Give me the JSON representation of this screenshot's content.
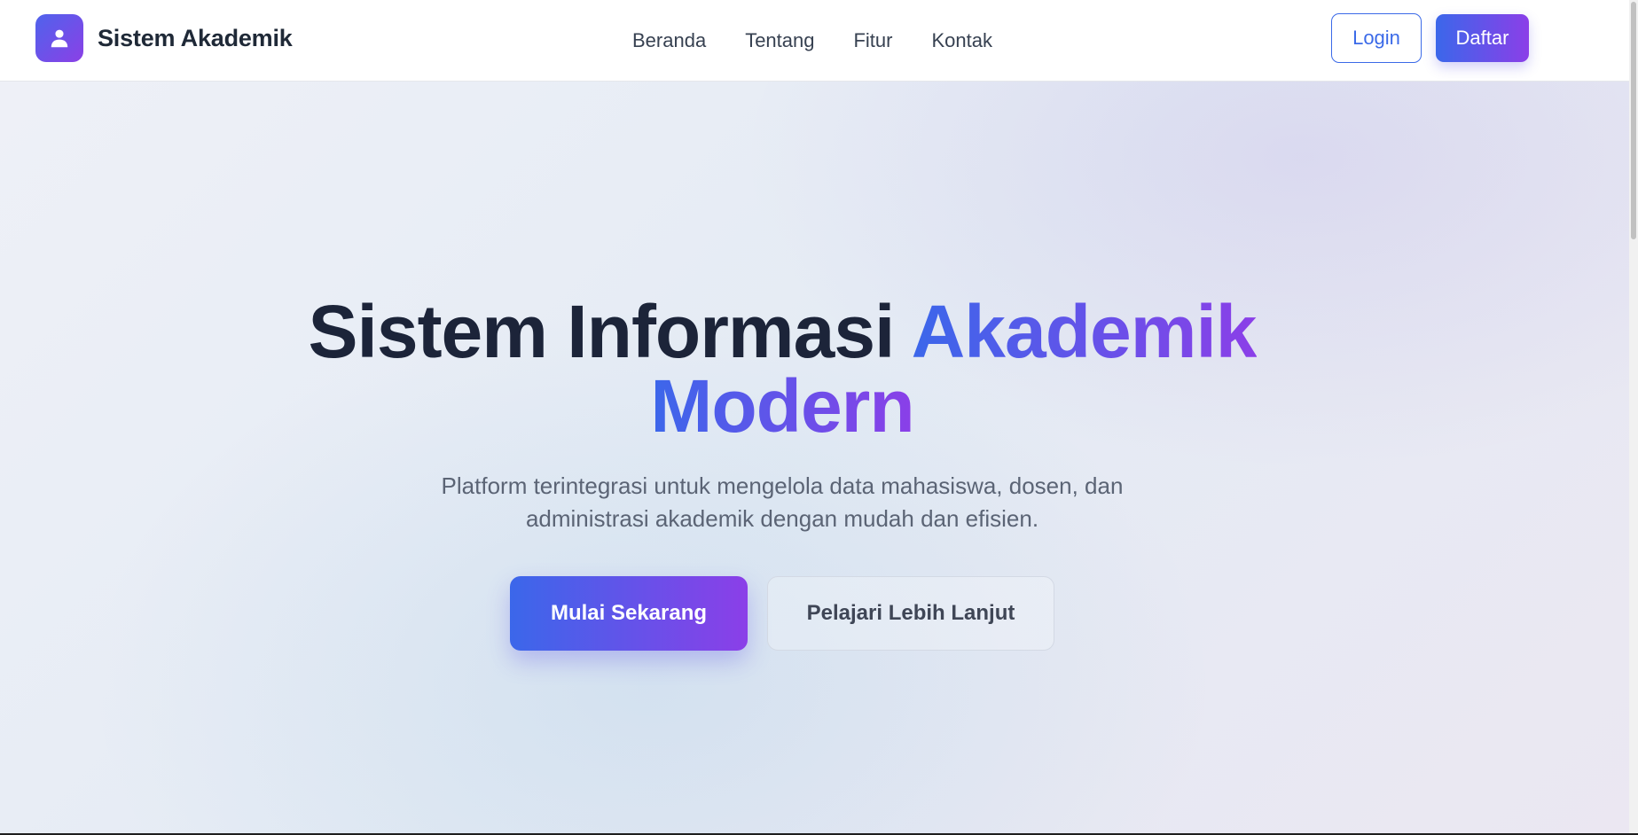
{
  "brand": {
    "name": "Sistem Akademik",
    "logo_icon": "user-icon"
  },
  "nav": {
    "links": [
      {
        "label": "Beranda"
      },
      {
        "label": "Tentang"
      },
      {
        "label": "Fitur"
      },
      {
        "label": "Kontak"
      }
    ],
    "login_label": "Login",
    "register_label": "Daftar"
  },
  "hero": {
    "title_plain": "Sistem Informasi",
    "title_highlight_1": "Akademik",
    "title_highlight_2": "Modern",
    "subtitle_line1": "Platform terintegrasi untuk mengelola data mahasiswa, dosen, dan",
    "subtitle_line2": "administrasi akademik dengan mudah dan efisien.",
    "primary_cta": "Mulai Sekarang",
    "secondary_cta": "Pelajari Lebih Lanjut"
  },
  "colors": {
    "gradient_start": "#3b67ea",
    "gradient_end": "#8b3fe8",
    "heading": "#1c2439",
    "body_text": "#5b6475"
  }
}
